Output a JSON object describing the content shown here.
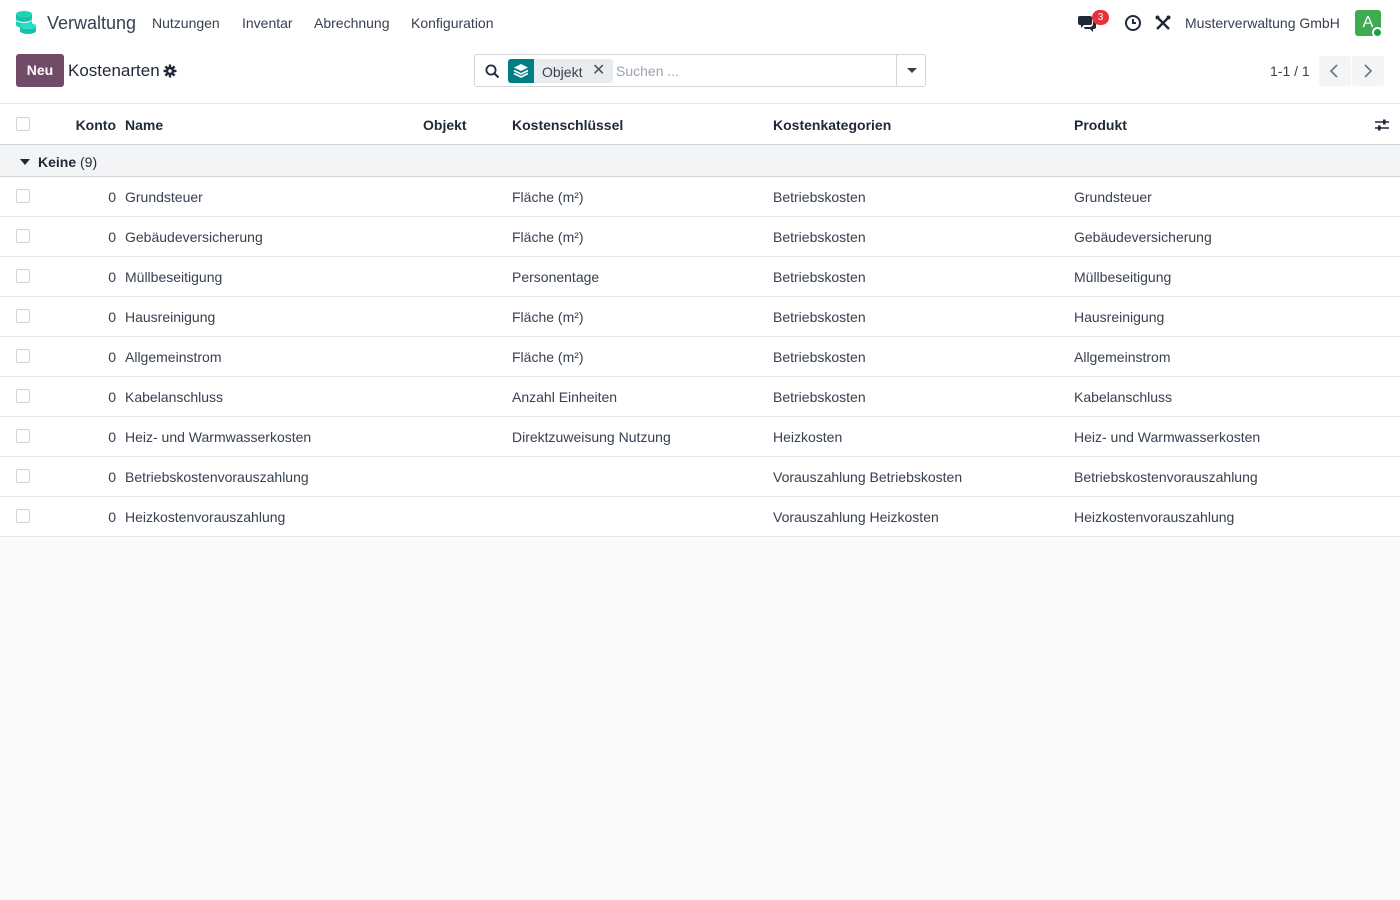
{
  "navbar": {
    "app_name": "Verwaltung",
    "menu": [
      "Nutzungen",
      "Inventar",
      "Abrechnung",
      "Konfiguration"
    ],
    "chat_count": "3",
    "company": "Musterverwaltung GmbH",
    "avatar_letter": "A"
  },
  "control": {
    "new_label": "Neu",
    "title": "Kostenarten",
    "facet_label": "Objekt",
    "facet_remove": "✕",
    "search_placeholder": "Suchen ...",
    "pager_value": "1-1 / 1"
  },
  "table": {
    "headers": [
      "Konto",
      "Name",
      "Objekt",
      "Kostenschlüssel",
      "Kostenkategorien",
      "Produkt"
    ],
    "group": {
      "label": "Keine",
      "count": "(9)"
    },
    "rows": [
      {
        "konto": "0",
        "name": "Grundsteuer",
        "objekt": "",
        "schluessel": "Fläche (m²)",
        "kategorie": "Betriebskosten",
        "produkt": "Grundsteuer"
      },
      {
        "konto": "0",
        "name": "Gebäudeversicherung",
        "objekt": "",
        "schluessel": "Fläche (m²)",
        "kategorie": "Betriebskosten",
        "produkt": "Gebäudeversicherung"
      },
      {
        "konto": "0",
        "name": "Müllbeseitigung",
        "objekt": "",
        "schluessel": "Personentage",
        "kategorie": "Betriebskosten",
        "produkt": "Müllbeseitigung"
      },
      {
        "konto": "0",
        "name": "Hausreinigung",
        "objekt": "",
        "schluessel": "Fläche (m²)",
        "kategorie": "Betriebskosten",
        "produkt": "Hausreinigung"
      },
      {
        "konto": "0",
        "name": "Allgemeinstrom",
        "objekt": "",
        "schluessel": "Fläche (m²)",
        "kategorie": "Betriebskosten",
        "produkt": "Allgemeinstrom"
      },
      {
        "konto": "0",
        "name": "Kabelanschluss",
        "objekt": "",
        "schluessel": "Anzahl Einheiten",
        "kategorie": "Betriebskosten",
        "produkt": "Kabelanschluss"
      },
      {
        "konto": "0",
        "name": "Heiz- und Warmwasserkosten",
        "objekt": "",
        "schluessel": "Direktzuweisung Nutzung",
        "kategorie": "Heizkosten",
        "produkt": "Heiz- und Warmwasserkosten"
      },
      {
        "konto": "0",
        "name": "Betriebskostenvorauszahlung",
        "objekt": "",
        "schluessel": "",
        "kategorie": "Vorauszahlung Betriebskosten",
        "produkt": "Betriebskostenvorauszahlung"
      },
      {
        "konto": "0",
        "name": "Heizkostenvorauszahlung",
        "objekt": "",
        "schluessel": "",
        "kategorie": "Vorauszahlung Heizkosten",
        "produkt": "Heizkostenvorauszahlung"
      }
    ]
  },
  "colors": {
    "brand": "#714b67",
    "facet_accent": "#017e84",
    "badge": "#e5323b",
    "avatar": "#3eab50",
    "app_icon": "#1ad3b7"
  },
  "icons": [
    "app-logo-icon",
    "chat-icon",
    "clock-icon",
    "tools-icon",
    "gear-icon",
    "search-icon",
    "layers-icon",
    "chevron-left-icon",
    "chevron-right-icon",
    "column-settings-icon"
  ]
}
